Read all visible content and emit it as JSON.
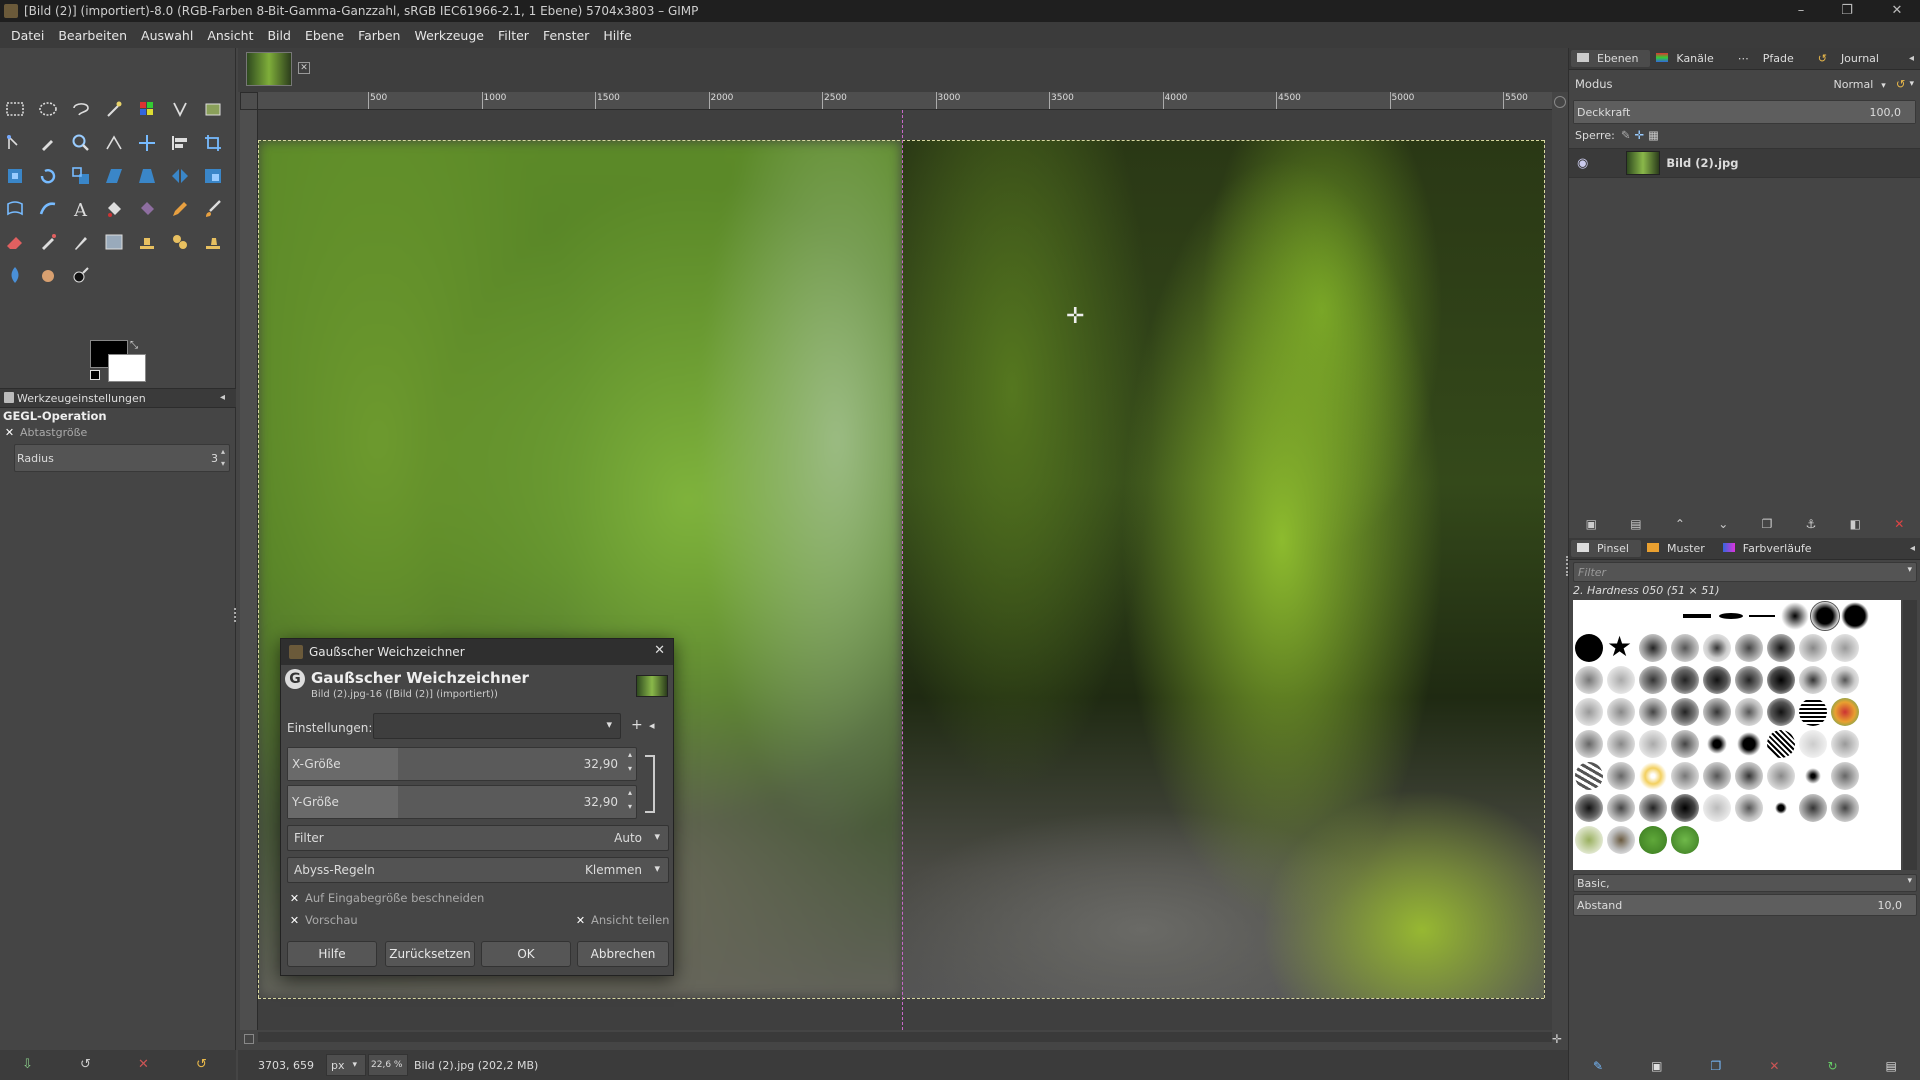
{
  "window": {
    "title": "[Bild (2)] (importiert)-8.0 (RGB-Farben 8-Bit-Gamma-Ganzzahl, sRGB IEC61966-2.1, 1 Ebene) 5704x3803 – GIMP",
    "minimize": "–",
    "maximize": "❐",
    "close": "✕"
  },
  "menu": [
    "Datei",
    "Bearbeiten",
    "Auswahl",
    "Ansicht",
    "Bild",
    "Ebene",
    "Farben",
    "Werkzeuge",
    "Filter",
    "Fenster",
    "Hilfe"
  ],
  "tool_options": {
    "tab_label": "Werkzeugeinstellungen",
    "heading": "GEGL-Operation",
    "sample_label": "Abtastgröße",
    "radius_label": "Radius",
    "radius_value": "3"
  },
  "ruler": {
    "ticks": [
      "500",
      "1000",
      "1500",
      "2000",
      "2500",
      "3000",
      "3500",
      "4000",
      "4500",
      "5000",
      "5500"
    ]
  },
  "statusbar": {
    "coords": "3703, 659",
    "unit": "px",
    "zoom": "22,6 %",
    "file_info": "Bild (2).jpg (202,2 MB)"
  },
  "layers_panel": {
    "tabs": [
      "Ebenen",
      "Kanäle",
      "Pfade",
      "Journal"
    ],
    "mode_label": "Modus",
    "mode_value": "Normal",
    "opacity_label": "Deckkraft",
    "opacity_value": "100,0",
    "lock_label": "Sperre:",
    "layer_name": "Bild (2).jpg"
  },
  "brushes_panel": {
    "tabs": [
      "Pinsel",
      "Muster",
      "Farbverläufe"
    ],
    "filter_placeholder": "Filter",
    "selected_brush": "2. Hardness 050 (51 × 51)",
    "preset": "Basic,",
    "spacing_label": "Abstand",
    "spacing_value": "10,0"
  },
  "dialog": {
    "window_title": "Gaußscher Weichzeichner",
    "heading": "Gaußscher Weichzeichner",
    "subheading": "Bild (2).jpg-16 ([Bild (2)] (importiert))",
    "presets_label": "Einstellungen:",
    "x_label": "X-Größe",
    "x_value": "32,90",
    "y_label": "Y-Größe",
    "y_value": "32,90",
    "filter_label": "Filter",
    "filter_value": "Auto",
    "abyss_label": "Abyss-Regeln",
    "abyss_value": "Klemmen",
    "clip_label": "Auf Eingabegröße beschneiden",
    "preview_label": "Vorschau",
    "split_label": "Ansicht teilen",
    "help_button": "Hilfe",
    "reset_button": "Zurücksetzen",
    "ok_button": "OK",
    "cancel_button": "Abbrechen"
  }
}
